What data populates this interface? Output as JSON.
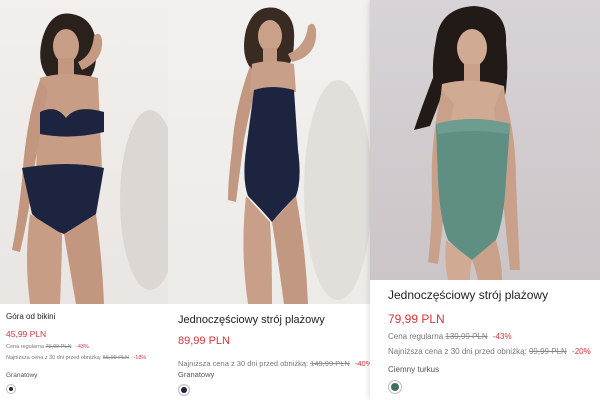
{
  "products": [
    {
      "title": "Góra od bikini",
      "price": "45,99 PLN",
      "regular_label": "Cena regularna",
      "regular_price": "79,99 PLN",
      "regular_discount": "-43%",
      "lowest_label": "Najniższa cena z 30 dni przed obniżką:",
      "lowest_price": "55,99 PLN",
      "lowest_discount": "-18%",
      "color_name": "Granatowy",
      "swatch_color": "#1c2440"
    },
    {
      "title": "Jednoczęściowy strój plażowy",
      "price": "89,99 PLN",
      "lowest_label": "Najniższa cena z 30 dni przed obniżką:",
      "lowest_price": "149,99 PLN",
      "lowest_discount": "-40%",
      "color_name": "Granatowy",
      "swatch_color": "#1c2440"
    },
    {
      "title": "Jednoczęściowy strój plażowy",
      "price": "79,99 PLN",
      "regular_label": "Cena regularna",
      "regular_price": "139,99 PLN",
      "regular_discount": "-43%",
      "lowest_label": "Najniższa cena z 30 dni przed obniżką:",
      "lowest_price": "99,99 PLN",
      "lowest_discount": "-20%",
      "color_name": "Ciemny turkus",
      "swatch_color": "#3f6f64"
    }
  ],
  "colors": {
    "sale_red": "#e0313b",
    "navy_swimsuit": "#1c2440",
    "teal_swimsuit": "#5f8f83"
  }
}
